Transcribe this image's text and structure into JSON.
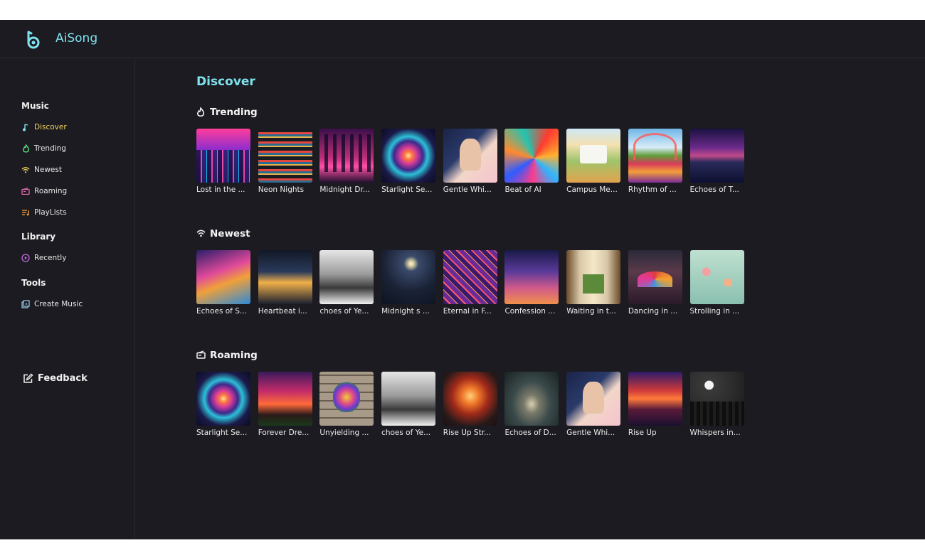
{
  "app": {
    "title": "AiSong"
  },
  "sidebar": {
    "music_title": "Music",
    "music_items": [
      {
        "label": "Discover",
        "icon": "music-note-icon",
        "color": "#7ee3ef"
      },
      {
        "label": "Trending",
        "icon": "flame-icon",
        "color": "#5ee07a"
      },
      {
        "label": "Newest",
        "icon": "wifi-icon",
        "color": "#f3d35a"
      },
      {
        "label": "Roaming",
        "icon": "radio-icon",
        "color": "#e06bb0"
      },
      {
        "label": "PlayLists",
        "icon": "playlist-icon",
        "color": "#f0a040"
      }
    ],
    "library_title": "Library",
    "library_items": [
      {
        "label": "Recently",
        "icon": "play-circle-icon",
        "color": "#c66be0"
      }
    ],
    "tools_title": "Tools",
    "tools_items": [
      {
        "label": "Create Music",
        "icon": "create-icon",
        "color": "#9ad0f0"
      }
    ],
    "feedback_label": "Feedback"
  },
  "main": {
    "title": "Discover",
    "sections": [
      {
        "title": "Trending",
        "icon": "flame-icon",
        "items": [
          "Lost in the ...",
          "Neon Nights",
          "Midnight Dr...",
          "Starlight Se...",
          "Gentle Whi...",
          "Beat of AI",
          "Campus Me...",
          "Rhythm of ...",
          "Echoes of T..."
        ]
      },
      {
        "title": "Newest",
        "icon": "wifi-icon",
        "items": [
          "Echoes of S...",
          "Heartbeat i...",
          "choes of Ye...",
          "Midnight s ...",
          "Eternal in F...",
          "Confession ...",
          "Waiting in t...",
          "Dancing in ...",
          "Strolling in ..."
        ]
      },
      {
        "title": "Roaming",
        "icon": "radio-icon",
        "items": [
          "Starlight Se...",
          "Forever Dre...",
          "Unyielding ...",
          "choes of Ye...",
          "Rise Up Str...",
          "Echoes of D...",
          "Gentle Whi...",
          "Rise Up",
          "Whispers in..."
        ]
      }
    ]
  }
}
